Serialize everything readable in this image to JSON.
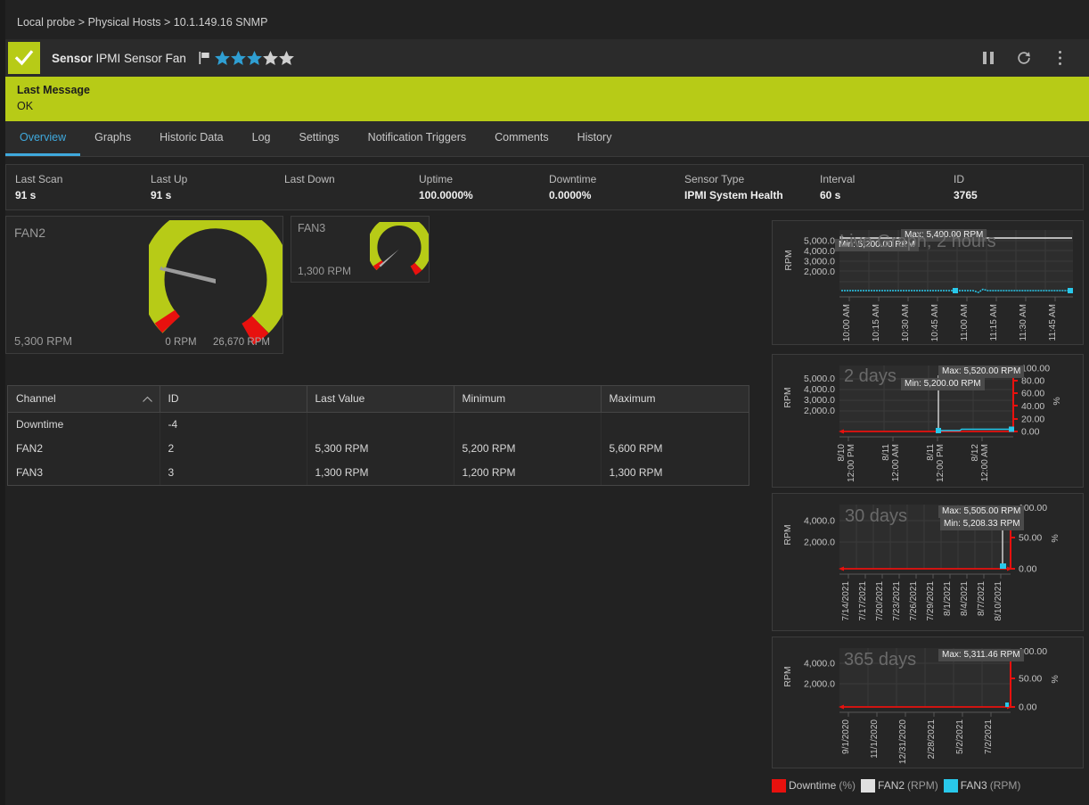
{
  "breadcrumb": "Local probe > Physical Hosts > 10.1.149.16 SNMP",
  "header": {
    "sensor_word": "Sensor",
    "sensor_name": "IPMI Sensor Fan",
    "status_icon": "check-icon",
    "priority_stars_filled": 3,
    "priority_stars_total": 5,
    "flag_icon": "flag-icon",
    "pause_icon": "pause-icon",
    "refresh_icon": "refresh-icon",
    "more_icon": "more-vertical-icon"
  },
  "last_message": {
    "title": "Last Message",
    "text": "OK"
  },
  "tabs": [
    {
      "label": "Overview",
      "active": true
    },
    {
      "label": "Graphs",
      "active": false
    },
    {
      "label": "Historic Data",
      "active": false
    },
    {
      "label": "Log",
      "active": false
    },
    {
      "label": "Settings",
      "active": false
    },
    {
      "label": "Notification Triggers",
      "active": false
    },
    {
      "label": "Comments",
      "active": false
    },
    {
      "label": "History",
      "active": false
    }
  ],
  "info": [
    {
      "key": "Last Scan",
      "value": "91 s"
    },
    {
      "key": "Last Up",
      "value": "91 s"
    },
    {
      "key": "Last Down",
      "value": ""
    },
    {
      "key": "Uptime",
      "value": "100.0000%"
    },
    {
      "key": "Downtime",
      "value": "0.0000%"
    },
    {
      "key": "Sensor Type",
      "value": "IPMI System Health"
    },
    {
      "key": "Interval",
      "value": "60 s"
    },
    {
      "key": "ID",
      "value": "3765"
    }
  ],
  "gauges": [
    {
      "name": "FAN2",
      "value_text": "5,300 RPM",
      "min_label": "0 RPM",
      "max_label": "26,670 RPM",
      "min": 0,
      "max": 26670,
      "value": 5300
    },
    {
      "name": "FAN3",
      "value_text": "1,300 RPM",
      "min_label": "",
      "max_label": "",
      "min": 0,
      "max": 26670,
      "value": 1300
    }
  ],
  "channel_table": {
    "columns": [
      "Channel",
      "ID",
      "Last Value",
      "Minimum",
      "Maximum"
    ],
    "sort_column": "Channel",
    "sort_direction": "asc",
    "rows": [
      {
        "channel": "Downtime",
        "id": "-4",
        "last_value": "",
        "minimum": "",
        "maximum": ""
      },
      {
        "channel": "FAN2",
        "id": "2",
        "last_value": "5,300 RPM",
        "minimum": "5,200 RPM",
        "maximum": "5,600 RPM"
      },
      {
        "channel": "FAN3",
        "id": "3",
        "last_value": "1,300 RPM",
        "minimum": "1,200 RPM",
        "maximum": "1,300 RPM"
      }
    ]
  },
  "legend": [
    {
      "name": "Downtime",
      "unit": "(%)",
      "color": "#e8110e"
    },
    {
      "name": "FAN2",
      "unit": "(RPM)",
      "color": "#e0e0e0"
    },
    {
      "name": "FAN3",
      "unit": "(RPM)",
      "color": "#29c8eb"
    }
  ],
  "chart_data": [
    {
      "id": "live",
      "type": "line",
      "title": "Live Graph, 2 hours",
      "ylabel": "RPM",
      "y2label": "",
      "ylim": [
        0,
        5800
      ],
      "yticks": [
        2000,
        3000,
        4000,
        5000
      ],
      "yticklabels": [
        "2,000.0",
        "3,000.0",
        "4,000.0",
        "5,000.0"
      ],
      "xticklabels": [
        "10:00 AM",
        "10:15 AM",
        "10:30 AM",
        "10:45 AM",
        "11:00 AM",
        "11:15 AM",
        "11:30 AM",
        "11:45 AM"
      ],
      "annotations": [
        "Max: 5,400.00 RPM",
        "Min: 5,200.00 RPM"
      ],
      "series": [
        {
          "name": "FAN2",
          "color": "#e0e0e0",
          "values": [
            5300,
            5300,
            5300,
            5300,
            5300,
            5300,
            5300,
            5300,
            5300
          ]
        },
        {
          "name": "FAN3",
          "color": "#29c8eb",
          "values": [
            1300,
            1300,
            1300,
            1300,
            1300,
            1280,
            1300,
            1300,
            1300
          ]
        }
      ]
    },
    {
      "id": "2days",
      "type": "line",
      "title": "2 days",
      "ylabel": "RPM",
      "y2label": "%",
      "ylim": [
        0,
        5800
      ],
      "yticks": [
        2000,
        3000,
        4000,
        5000
      ],
      "yticklabels": [
        "2,000.0",
        "3,000.0",
        "4,000.0",
        "5,000.0"
      ],
      "y2ticklabels": [
        "0.00",
        "20.00",
        "40.00",
        "60.00",
        "80.00",
        "100.00"
      ],
      "xticklabels": [
        "8/10\n12:00 PM",
        "8/11\n12:00 AM",
        "8/11\n12:00 PM",
        "8/12\n12:00 AM"
      ],
      "annotations": [
        "Max: 5,520.00 RPM",
        "Min: 5,200.00 RPM"
      ],
      "series": [
        {
          "name": "Downtime",
          "color": "#e8110e",
          "values": [
            0,
            0,
            0,
            0
          ]
        },
        {
          "name": "FAN2",
          "color": "#e0e0e0",
          "values": [
            null,
            null,
            5300,
            5300
          ]
        },
        {
          "name": "FAN3",
          "color": "#29c8eb",
          "values": [
            null,
            null,
            1300,
            1300
          ]
        }
      ]
    },
    {
      "id": "30days",
      "type": "line",
      "title": "30 days",
      "ylabel": "RPM",
      "y2label": "%",
      "ylim": [
        0,
        5800
      ],
      "yticks": [
        2000,
        4000
      ],
      "yticklabels": [
        "2,000.0",
        "4,000.0"
      ],
      "y2ticklabels": [
        "0.00",
        "50.00",
        "100.00"
      ],
      "xticklabels": [
        "7/14/2021",
        "7/17/2021",
        "7/20/2021",
        "7/23/2021",
        "7/26/2021",
        "7/29/2021",
        "8/1/2021",
        "8/4/2021",
        "8/7/2021",
        "8/10/2021"
      ],
      "annotations": [
        "Max: 5,505.00 RPM",
        "Min: 5,208.33 RPM"
      ],
      "series": [
        {
          "name": "Downtime",
          "color": "#e8110e",
          "values": [
            0,
            0,
            0,
            0,
            0,
            0,
            0,
            0,
            0,
            0
          ]
        },
        {
          "name": "FAN2",
          "color": "#e0e0e0",
          "values": [
            null,
            null,
            null,
            null,
            null,
            null,
            null,
            null,
            null,
            5300
          ]
        },
        {
          "name": "FAN3",
          "color": "#29c8eb",
          "values": [
            null,
            null,
            null,
            null,
            null,
            null,
            null,
            null,
            null,
            1300
          ]
        }
      ]
    },
    {
      "id": "365days",
      "type": "line",
      "title": "365 days",
      "ylabel": "RPM",
      "y2label": "%",
      "ylim": [
        0,
        5800
      ],
      "yticks": [
        2000,
        4000
      ],
      "yticklabels": [
        "2,000.0",
        "4,000.0"
      ],
      "y2ticklabels": [
        "0.00",
        "50.00",
        "100.00"
      ],
      "xticklabels": [
        "9/1/2020",
        "11/1/2020",
        "12/31/2020",
        "2/28/2021",
        "5/2/2021",
        "7/2/2021"
      ],
      "annotations": [
        "Max: 5,311.46 RPM"
      ],
      "series": [
        {
          "name": "Downtime",
          "color": "#e8110e",
          "values": [
            0,
            0,
            0,
            0,
            0,
            0
          ]
        },
        {
          "name": "FAN2",
          "color": "#e0e0e0",
          "values": [
            null,
            null,
            null,
            null,
            null,
            5300
          ]
        },
        {
          "name": "FAN3",
          "color": "#29c8eb",
          "values": [
            null,
            null,
            null,
            null,
            null,
            1300
          ]
        }
      ]
    }
  ]
}
